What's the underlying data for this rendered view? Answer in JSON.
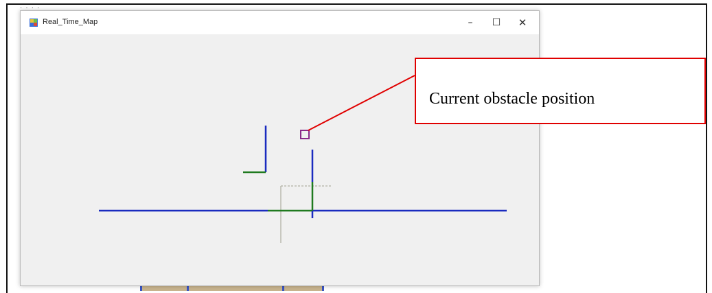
{
  "window": {
    "title": "Real_Time_Map",
    "minimize_glyph": "–",
    "maximize_glyph": "☐",
    "close_glyph": "✕",
    "icon": "app-map-icon"
  },
  "map": {
    "wall_color": "#1a2bbf",
    "segment_color": "#1f7a1f",
    "obstacle_color": "#8a2a8a",
    "guide_color": "#a0a090"
  },
  "callout": {
    "text": "Current obstacle position",
    "border_color": "#e00000"
  }
}
